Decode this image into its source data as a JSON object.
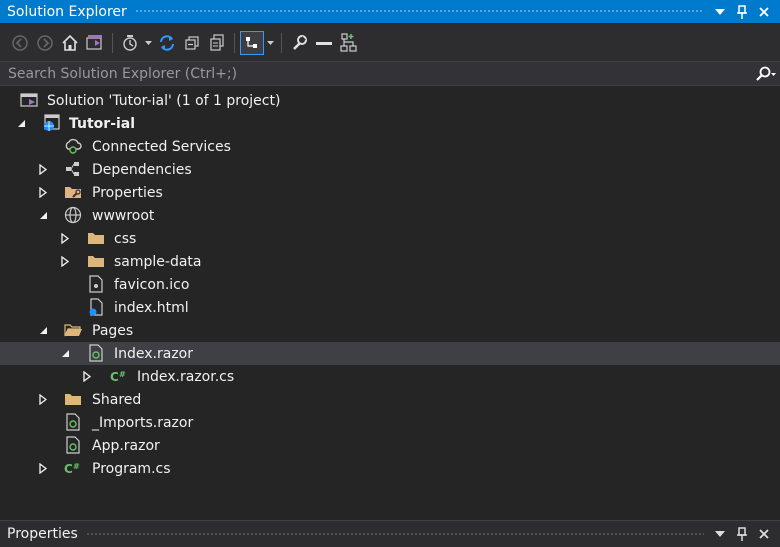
{
  "window": {
    "title": "Solution Explorer"
  },
  "toolbar": {
    "buttons": [
      {
        "name": "back-icon"
      },
      {
        "name": "forward-icon"
      },
      {
        "name": "home-icon"
      },
      {
        "name": "vs-switch-views-icon"
      },
      {
        "name": "pending-changes-filter-icon"
      },
      {
        "name": "sync-icon"
      },
      {
        "name": "collapse-all-icon"
      },
      {
        "name": "show-all-files-icon"
      },
      {
        "name": "preview-selected-icon"
      },
      {
        "name": "properties-icon"
      },
      {
        "name": "minus-icon"
      },
      {
        "name": "code-map-icon"
      }
    ]
  },
  "search": {
    "placeholder": "Search Solution Explorer (Ctrl+;)"
  },
  "tree": {
    "items": [
      {
        "label": "Solution 'Tutor-ial' (1 of 1 project)",
        "icon": "solution-icon",
        "expander": "none",
        "bold": false
      },
      {
        "label": "Tutor-ial",
        "icon": "web-project-icon",
        "expander": "expanded",
        "bold": true
      },
      {
        "label": "Connected Services",
        "icon": "connected-services-icon",
        "expander": "none",
        "bold": false
      },
      {
        "label": "Dependencies",
        "icon": "dependencies-icon",
        "expander": "collapsed",
        "bold": false
      },
      {
        "label": "Properties",
        "icon": "properties-folder-icon",
        "expander": "collapsed",
        "bold": false
      },
      {
        "label": "wwwroot",
        "icon": "globe-icon",
        "expander": "expanded",
        "bold": false
      },
      {
        "label": "css",
        "icon": "folder-icon",
        "expander": "collapsed",
        "bold": false
      },
      {
        "label": "sample-data",
        "icon": "folder-icon",
        "expander": "collapsed",
        "bold": false
      },
      {
        "label": "favicon.ico",
        "icon": "image-file-icon",
        "expander": "none",
        "bold": false
      },
      {
        "label": "index.html",
        "icon": "html-file-icon",
        "expander": "none",
        "bold": false
      },
      {
        "label": "Pages",
        "icon": "folder-open-icon",
        "expander": "expanded",
        "bold": false
      },
      {
        "label": "Index.razor",
        "icon": "razor-file-icon",
        "expander": "expanded",
        "bold": false,
        "selected": true
      },
      {
        "label": "Index.razor.cs",
        "icon": "csharp-file-icon",
        "expander": "collapsed",
        "bold": false
      },
      {
        "label": "Shared",
        "icon": "folder-icon",
        "expander": "collapsed",
        "bold": false
      },
      {
        "label": "_Imports.razor",
        "icon": "razor-file-icon",
        "expander": "none",
        "bold": false
      },
      {
        "label": "App.razor",
        "icon": "razor-file-icon",
        "expander": "none",
        "bold": false
      },
      {
        "label": "Program.cs",
        "icon": "csharp-file-icon",
        "expander": "collapsed",
        "bold": false
      }
    ]
  },
  "properties_panel": {
    "title": "Properties"
  },
  "colors": {
    "accent": "#007acc",
    "background": "#252526",
    "selection": "#3f3f46",
    "folder": "#dcb67a",
    "csharp": "#68c06a"
  }
}
